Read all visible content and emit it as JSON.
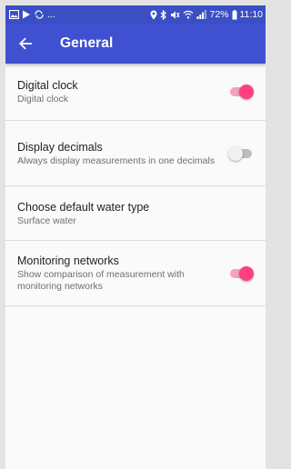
{
  "status_bar": {
    "dots": "...",
    "battery_percent": "72%",
    "time": "11:10",
    "icons": [
      "image-icon",
      "play-store-icon",
      "sync-icon",
      "location-icon",
      "bluetooth-icon",
      "mute-icon",
      "wifi-icon",
      "signal-icon",
      "battery-icon"
    ]
  },
  "app_bar": {
    "title": "General",
    "back_icon": "back-arrow-icon",
    "color": "#3f51d0"
  },
  "settings": [
    {
      "title": "Digital clock",
      "subtitle": "Digital clock",
      "toggle": true
    },
    {
      "title": "Display decimals",
      "subtitle": "Always display measurements in one decimals",
      "toggle": false
    },
    {
      "title": "Choose default water type",
      "subtitle": "Surface water",
      "toggle": null
    },
    {
      "title": "Monitoring networks",
      "subtitle": "Show comparison of measurement with monitoring networks",
      "toggle": true
    }
  ],
  "colors": {
    "accent": "#ff3f80",
    "status_bar": "#3b4fc4"
  }
}
